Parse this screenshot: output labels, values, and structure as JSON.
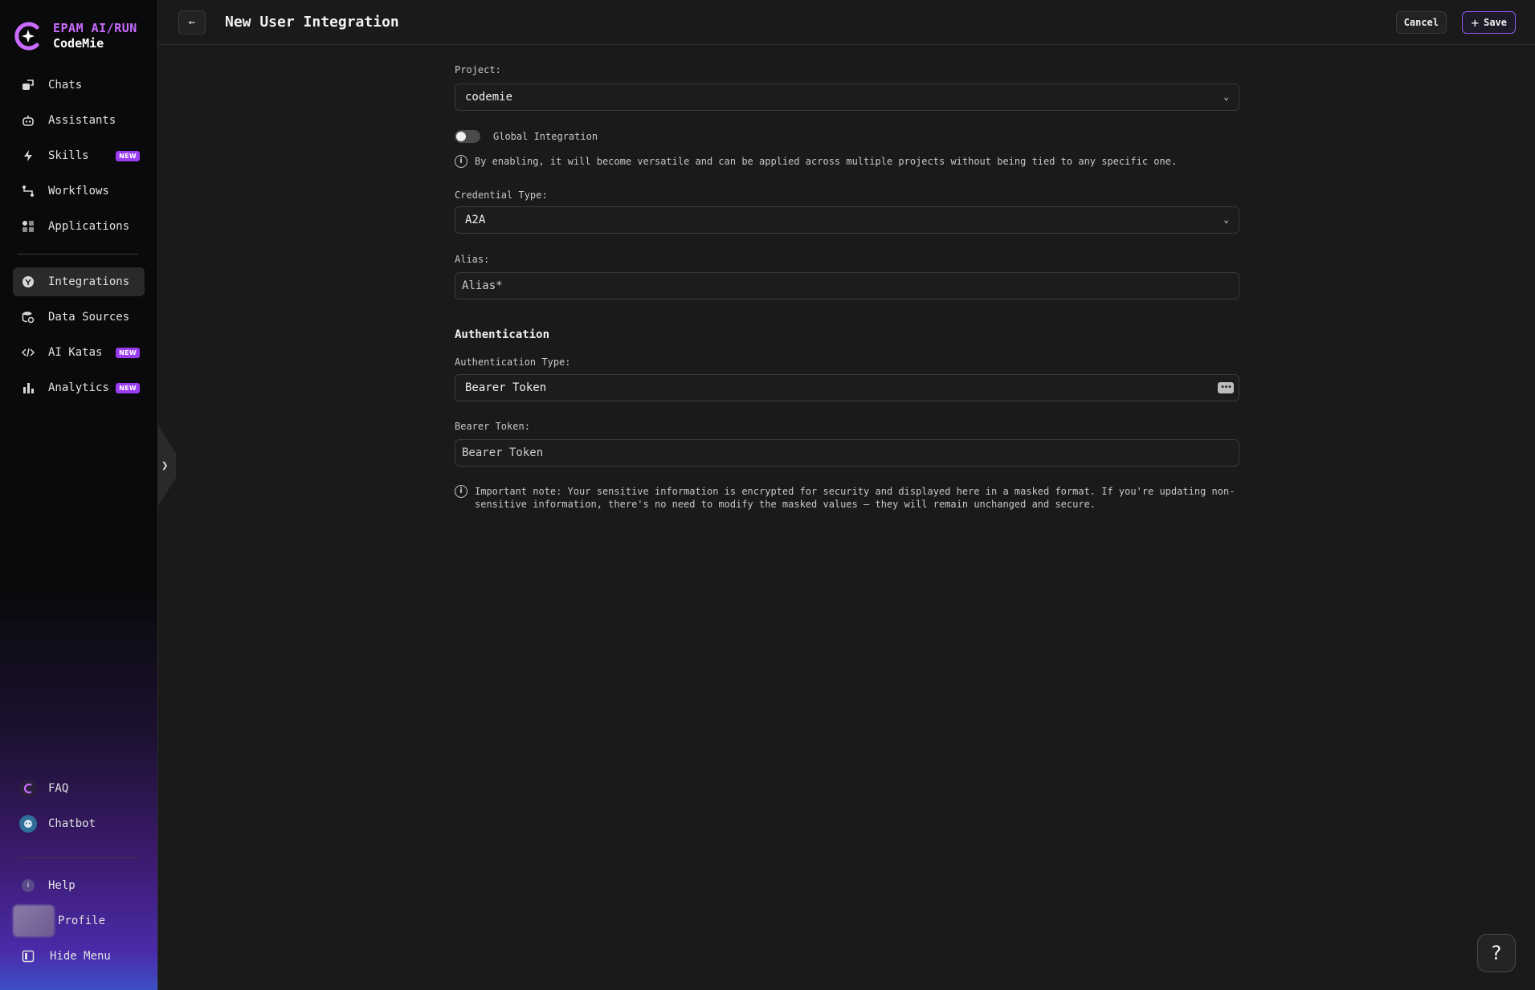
{
  "brand": {
    "line1": "EPAM AI/RUN",
    "line2": "CodeMie"
  },
  "sidebar": {
    "items": [
      {
        "label": "Chats"
      },
      {
        "label": "Assistants"
      },
      {
        "label": "Skills",
        "badge": "NEW"
      },
      {
        "label": "Workflows"
      },
      {
        "label": "Applications"
      }
    ],
    "items2": [
      {
        "label": "Integrations",
        "active": true
      },
      {
        "label": "Data Sources"
      },
      {
        "label": "AI Katas",
        "badge": "NEW"
      },
      {
        "label": "Analytics",
        "badge": "NEW"
      }
    ],
    "bottom": [
      {
        "label": "FAQ"
      },
      {
        "label": "Chatbot"
      }
    ],
    "footer": [
      {
        "label": "Help"
      },
      {
        "label": "Profile"
      },
      {
        "label": "Hide Menu"
      }
    ],
    "accent": "#9a3cf0"
  },
  "header": {
    "title": "New User Integration",
    "cancel_label": "Cancel",
    "save_label": "Save"
  },
  "form": {
    "project_label": "Project:",
    "project_value": "codemie",
    "global_label": "Global Integration",
    "global_enabled": false,
    "global_info": "By enabling, it will become versatile and can be applied across multiple projects without being tied to any specific one.",
    "credential_label": "Credential Type:",
    "credential_value": "A2A",
    "alias_label": "Alias:",
    "alias_placeholder": "Alias*",
    "auth_section": "Authentication",
    "auth_type_label": "Authentication Type:",
    "auth_type_value": "Bearer Token",
    "bearer_label": "Bearer Token:",
    "bearer_placeholder": "Bearer Token",
    "note_line1": "Important note: Your sensitive information is encrypted for security and displayed here in a masked format. If you're updating non-",
    "note_line2": "sensitive information, there's no need to modify the masked values — they will remain unchanged and secure."
  },
  "help_fab": "?"
}
